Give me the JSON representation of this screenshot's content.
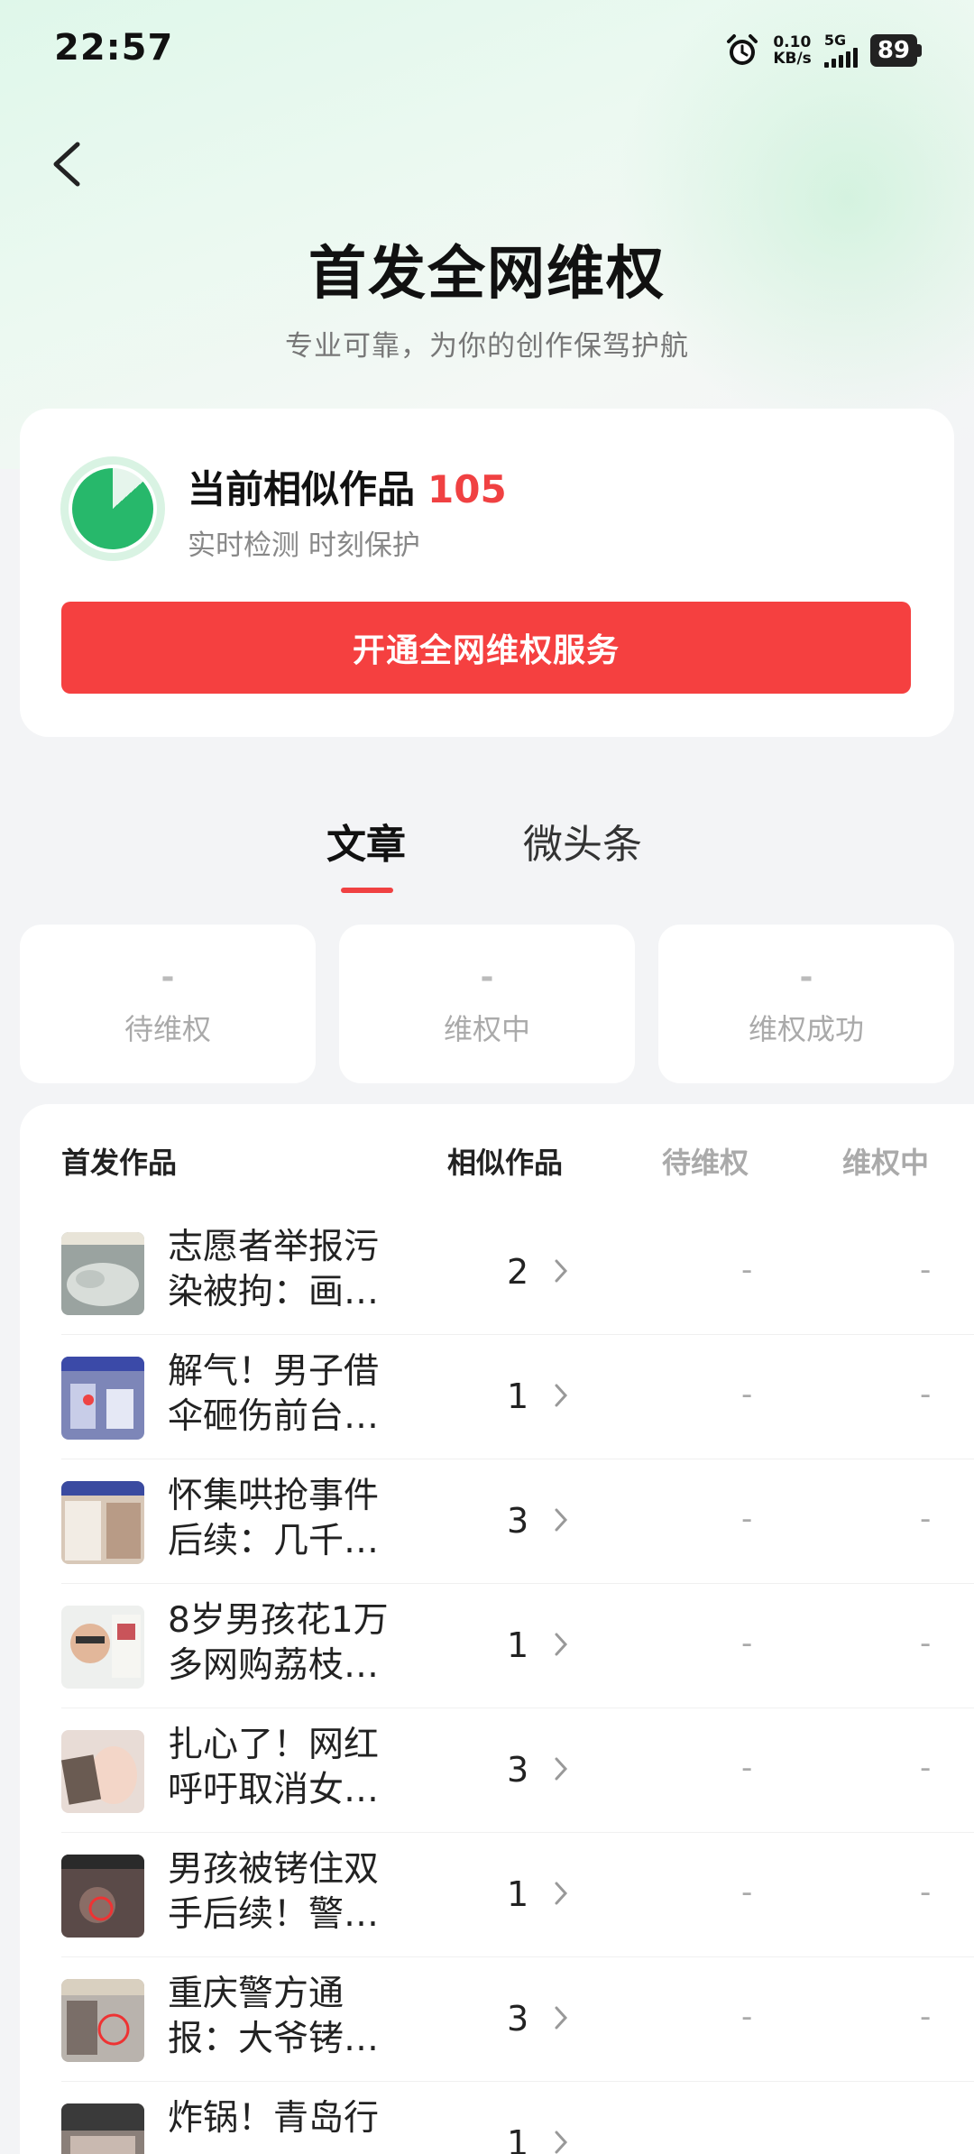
{
  "status_bar": {
    "time": "22:57",
    "net_speed_value": "0.10",
    "net_speed_unit": "KB/s",
    "signal_label": "5G",
    "battery": "89",
    "icons": [
      "alarm-icon",
      "signal-icon",
      "battery-icon"
    ]
  },
  "header": {
    "title": "首发全网维权",
    "subtitle": "专业可靠，为你的创作保驾护航",
    "back_icon": "chevron-left-icon"
  },
  "summary": {
    "label": "当前相似作品",
    "count": "105",
    "tags": "实时检测 时刻保护",
    "cta_label": "开通全网维权服务",
    "colors": {
      "accent": "#f54040",
      "ring": "#27b86b"
    }
  },
  "tabs": [
    {
      "label": "文章",
      "active": true
    },
    {
      "label": "微头条",
      "active": false
    }
  ],
  "stats": [
    {
      "value": "-",
      "label": "待维权"
    },
    {
      "value": "-",
      "label": "维权中"
    },
    {
      "value": "-",
      "label": "维权成功"
    }
  ],
  "table": {
    "headers": [
      "首发作品",
      "相似作品",
      "待维权",
      "维权中"
    ],
    "rows": [
      {
        "title": "志愿者举报污染被拘：画…",
        "similar": "2",
        "pending": "-",
        "in_progress": "-"
      },
      {
        "title": "解气！男子借伞砸伤前台…",
        "similar": "1",
        "pending": "-",
        "in_progress": "-"
      },
      {
        "title": "怀集哄抢事件后续：几千…",
        "similar": "3",
        "pending": "-",
        "in_progress": "-"
      },
      {
        "title": "8岁男孩花1万多网购荔枝…",
        "similar": "1",
        "pending": "-",
        "in_progress": "-"
      },
      {
        "title": "扎心了！网红呼吁取消女…",
        "similar": "3",
        "pending": "-",
        "in_progress": "-"
      },
      {
        "title": "男孩被铐住双手后续！警…",
        "similar": "1",
        "pending": "-",
        "in_progress": "-"
      },
      {
        "title": "重庆警方通报：大爷铐…",
        "similar": "3",
        "pending": "-",
        "in_progress": "-"
      },
      {
        "title": "炸锅！青岛行",
        "similar": "1",
        "pending": "",
        "in_progress": ""
      }
    ]
  }
}
